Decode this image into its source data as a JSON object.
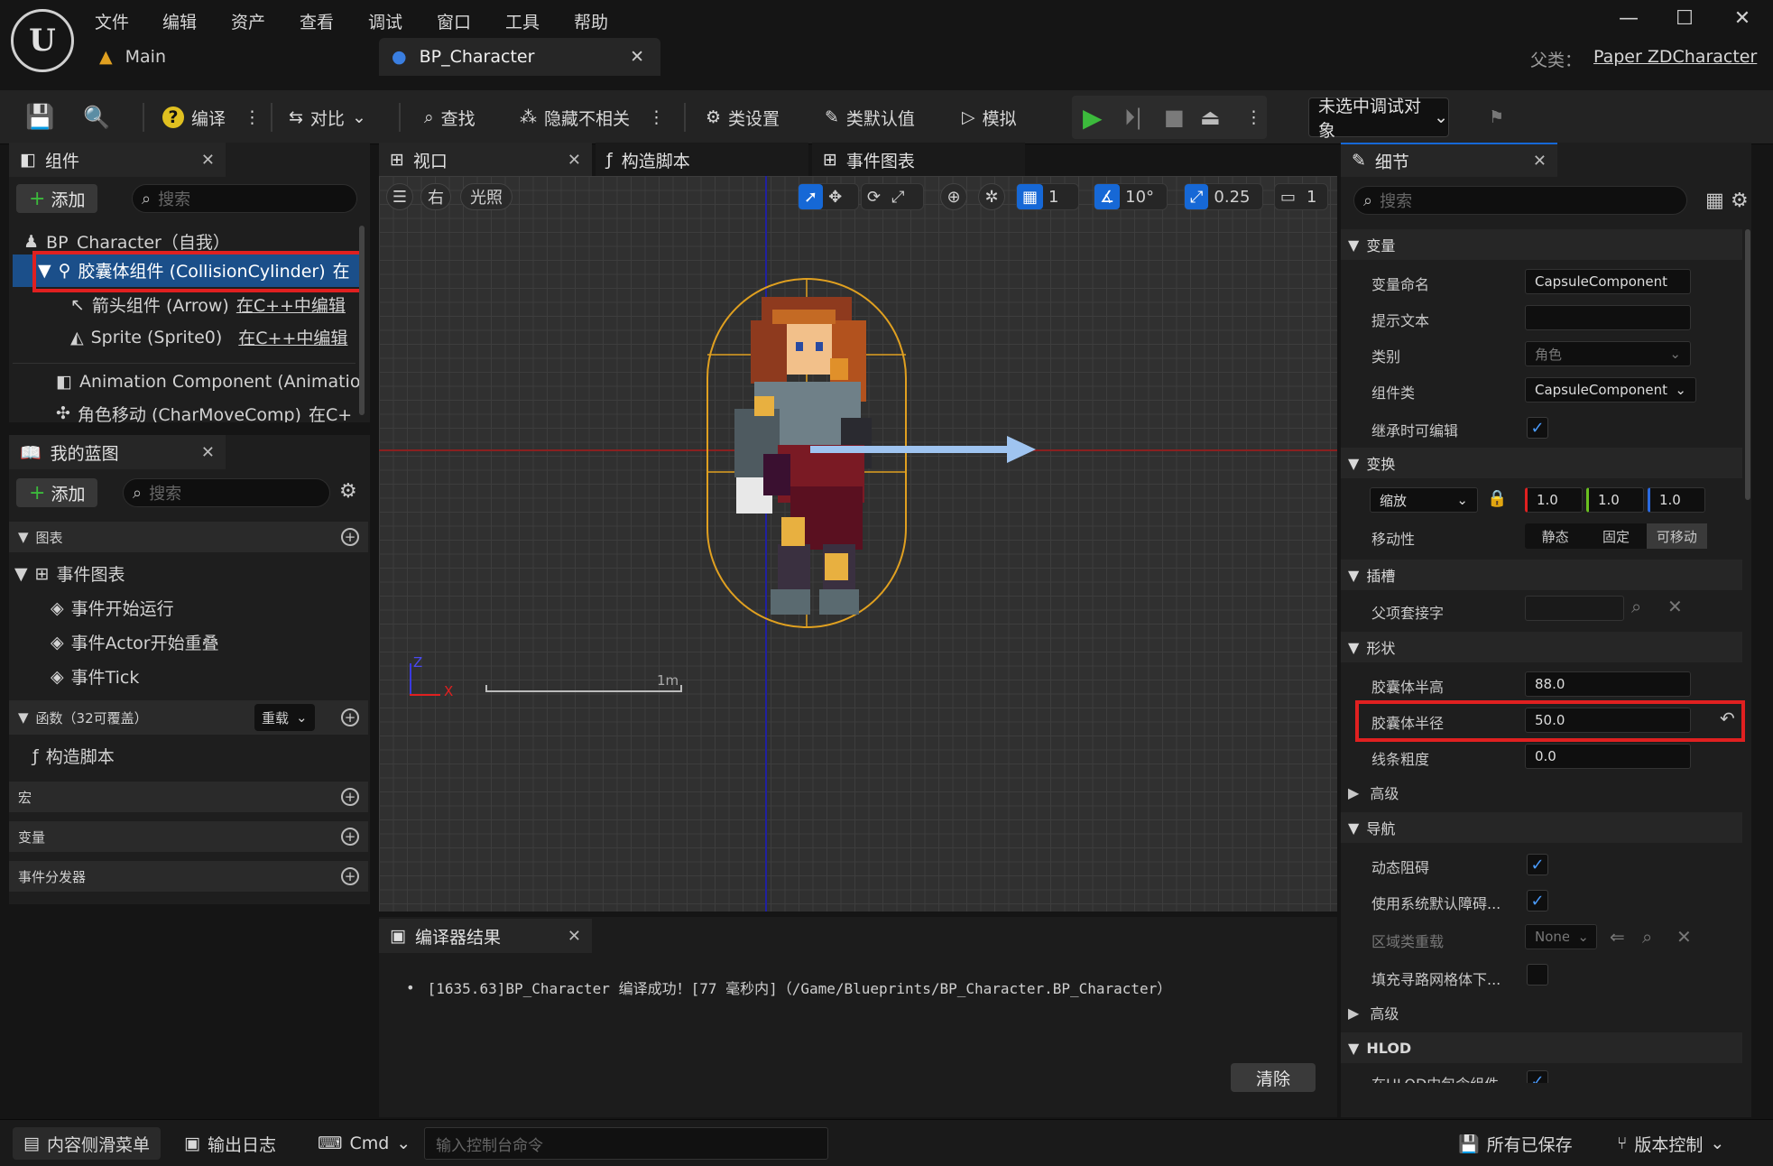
{
  "menu": [
    "文件",
    "编辑",
    "资产",
    "查看",
    "调试",
    "窗口",
    "工具",
    "帮助"
  ],
  "tabs": {
    "main": "Main",
    "blueprint": "BP_Character"
  },
  "parent_class": {
    "label": "父类：",
    "value": "Paper ZDCharacter"
  },
  "toolbar": {
    "compile": "编译",
    "diff": "对比",
    "find": "查找",
    "hide_unrelated": "隐藏不相关",
    "class_settings": "类设置",
    "class_defaults": "类默认值",
    "simulate": "模拟",
    "debug_target": "未选中调试对象"
  },
  "components": {
    "tab": "组件",
    "add": "添加",
    "search_placeholder": "搜索",
    "items": [
      {
        "name": "BP_Character（自我）"
      },
      {
        "name": "胶囊体组件 (CollisionCylinder)",
        "note": "在"
      },
      {
        "name": "箭头组件 (Arrow)",
        "note": "在C++中编辑"
      },
      {
        "name": "Sprite (Sprite0)",
        "note": "在C++中编辑"
      },
      {
        "name": "Animation Component (Animatio"
      },
      {
        "name": "角色移动 (CharMoveComp)",
        "note": "在C+"
      }
    ]
  },
  "my_blueprint": {
    "tab": "我的蓝图",
    "add": "添加",
    "search_placeholder": "搜索",
    "graphs_header": "图表",
    "event_graph": "事件图表",
    "events": [
      "事件开始运行",
      "事件Actor开始重叠",
      "事件Tick"
    ],
    "functions_header": "函数（32可覆盖）",
    "override": "重载",
    "construction_script": "构造脚本",
    "macros": "宏",
    "variables": "变量",
    "dispatchers": "事件分发器"
  },
  "center_tabs": {
    "viewport": "视口",
    "construction": "构造脚本",
    "event_graph": "事件图表"
  },
  "viewport": {
    "view_right": "右",
    "lit": "光照",
    "grid_value": "1",
    "angle_value": "10°",
    "scale_value": "0.25",
    "camera_value": "1",
    "axis_z": "Z",
    "axis_x": "X",
    "scale_label": "1m"
  },
  "compiler": {
    "tab": "编译器结果",
    "message": "[1635.63]BP_Character 编译成功！[77 毫秒内]（/Game/Blueprints/BP_Character.BP_Character）",
    "clear": "清除"
  },
  "details": {
    "tab": "细节",
    "search_placeholder": "搜索",
    "var_header": "变量",
    "var_name_label": "变量命名",
    "var_name": "CapsuleComponent",
    "tooltip_label": "提示文本",
    "tooltip": "",
    "category_label": "类别",
    "category": "角色",
    "comp_class_label": "组件类",
    "comp_class": "CapsuleComponent",
    "editable_label": "继承时可编辑",
    "editable": true,
    "transform_header": "变换",
    "scale_mode": "缩放",
    "scale": [
      "1.0",
      "1.0",
      "1.0"
    ],
    "mobility_label": "移动性",
    "mobility": [
      "静态",
      "固定",
      "可移动"
    ],
    "sockets_header": "插槽",
    "parent_socket_label": "父项套接字",
    "shape_header": "形状",
    "half_height_label": "胶囊体半高",
    "half_height": "88.0",
    "radius_label": "胶囊体半径",
    "radius": "50.0",
    "line_thickness_label": "线条粗度",
    "line_thickness": "0.0",
    "advanced": "高级",
    "nav_header": "导航",
    "dyn_obstacle_label": "动态阻碍",
    "dyn_obstacle": true,
    "sys_default_label": "使用系统默认障碍...",
    "sys_default": true,
    "area_override_label": "区域类重载",
    "area_override": "None",
    "fill_nav_label": "填充寻路网格体下...",
    "fill_nav": false,
    "advanced2": "高级",
    "hlod_header": "HLOD",
    "hlod_item_label": "在HLOD中包含组件"
  },
  "statusbar": {
    "content_drawer": "内容侧滑菜单",
    "output_log": "输出日志",
    "cmd": "Cmd",
    "console_placeholder": "输入控制台命令",
    "all_saved": "所有已保存",
    "source_control": "版本控制"
  },
  "colors": {
    "accent": "#1668d6",
    "highlight": "#e02020",
    "play": "#3cba3c"
  }
}
